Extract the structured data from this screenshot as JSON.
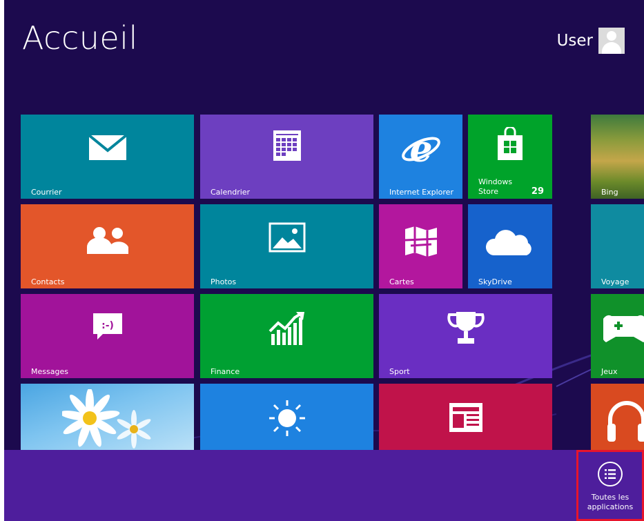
{
  "start": {
    "title": "Accueil",
    "user_name": "User"
  },
  "tiles": {
    "courrier": "Courrier",
    "calendrier": "Calendrier",
    "internet_explorer": "Internet Explorer",
    "windows_store": "Windows\nStore",
    "windows_store_count": "29",
    "bing": "Bing",
    "contacts": "Contacts",
    "photos": "Photos",
    "cartes": "Cartes",
    "skydrive": "SkyDrive",
    "voyage": "Voyage",
    "messages": "Messages",
    "finance": "Finance",
    "sport": "Sport",
    "jeux": "Jeux"
  },
  "app_bar": {
    "all_apps_label": "Toutes les\napplications"
  },
  "colors": {
    "background": "#1c0a4e",
    "app_bar": "#4e1e9c",
    "highlight": "#e8152c"
  },
  "icons": [
    "mail-icon",
    "calendar-icon",
    "internet-explorer-icon",
    "store-bag-icon",
    "contacts-icon",
    "photos-icon",
    "maps-icon",
    "cloud-icon",
    "messaging-icon",
    "finance-chart-icon",
    "trophy-icon",
    "sun-icon",
    "news-icon",
    "gamepad-icon",
    "headphones-icon",
    "all-apps-list-icon",
    "user-avatar-icon"
  ]
}
